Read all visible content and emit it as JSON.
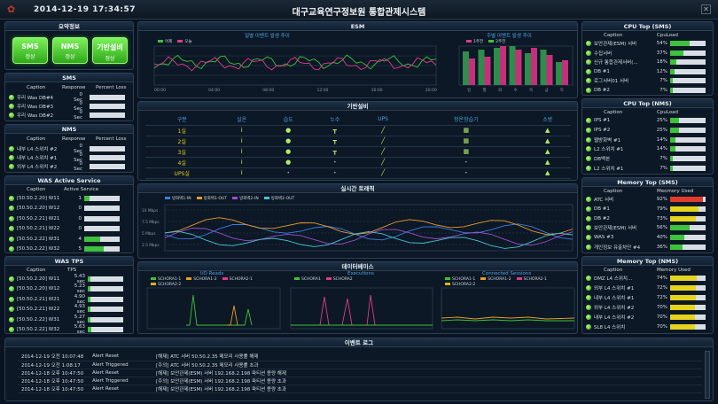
{
  "header": {
    "logo_icon": "red-flower-logo",
    "clock": "2014-12-19 17:34:57",
    "title": "대구교육연구정보원 통합관제시스템",
    "close_icon": "close-icon",
    "close_glyph": "✕"
  },
  "summary": {
    "title": "요약정보",
    "buttons": [
      {
        "label": "SMS",
        "status": "정상"
      },
      {
        "label": "NMS",
        "status": "정상"
      },
      {
        "label": "기반설비",
        "status": "정상"
      }
    ]
  },
  "sms": {
    "title": "SMS",
    "columns": [
      "Caption",
      "Response",
      "Percent Loss"
    ],
    "rows": [
      {
        "caption": "우리 Was DB#4",
        "response": "0 Sec"
      },
      {
        "caption": "우리 Was DB#3",
        "response": "0 Sec"
      },
      {
        "caption": "우리 Was DB#2",
        "response": "0 Sec"
      }
    ]
  },
  "nms": {
    "title": "NMS",
    "columns": [
      "Caption",
      "Response",
      "Percent Loss"
    ],
    "rows": [
      {
        "caption": "내부 L4 스위치 #2",
        "response": "0 Sec"
      },
      {
        "caption": "내부 L4 스위치 #1",
        "response": "0 Sec"
      },
      {
        "caption": "외부 L4 스위치 #2",
        "response": "0 Sec"
      }
    ]
  },
  "was_active": {
    "title": "WAS Active Service",
    "columns": [
      "Caption",
      "Active Service"
    ],
    "rows": [
      {
        "caption": "[50.50.2.20] W11",
        "value": "1",
        "fill": 0.15
      },
      {
        "caption": "[50.50.2.20] W12",
        "value": "0",
        "fill": 0
      },
      {
        "caption": "[50.50.2.21] W21",
        "value": "0",
        "fill": 0
      },
      {
        "caption": "[50.50.2.21] W22",
        "value": "0",
        "fill": 0
      },
      {
        "caption": "[50.50.2.22] W31",
        "value": "4",
        "fill": 0.45
      },
      {
        "caption": "[50.50.2.22] W32",
        "value": "5",
        "fill": 0.55
      }
    ]
  },
  "was_tps": {
    "title": "WAS TPS",
    "columns": [
      "Caption",
      "TPS"
    ],
    "rows": [
      {
        "caption": "[50.50.2.20] W11",
        "value": "5.43 sec",
        "fill": 0.08
      },
      {
        "caption": "[50.50.2.20] W12",
        "value": "5.23 sec",
        "fill": 0.08
      },
      {
        "caption": "[50.50.2.21] W21",
        "value": "4.90 sec",
        "fill": 0.07
      },
      {
        "caption": "[50.50.2.21] W22",
        "value": "4.93 sec",
        "fill": 0.07
      },
      {
        "caption": "[50.50.2.22] W31",
        "value": "5.27 sec",
        "fill": 0.08
      },
      {
        "caption": "[50.50.2.22] W32",
        "value": "5.63 sec",
        "fill": 0.09
      }
    ]
  },
  "esm": {
    "title": "ESM",
    "left_title": "일별 이벤트 발생 추이",
    "right_title": "주별 이벤트 발생 추이",
    "left_legend": [
      "어제",
      "오늘"
    ],
    "right_legend": [
      "1주전",
      "2주전"
    ],
    "left_x": [
      "00:00",
      "04:00",
      "08:00",
      "12:00",
      "16:00",
      "20:00"
    ],
    "right_x": [
      "일",
      "월",
      "화",
      "수",
      "목",
      "금",
      "토"
    ]
  },
  "facility": {
    "title": "기반설비",
    "columns": [
      "구분",
      "실온",
      "습도",
      "누수",
      "UPS",
      "항온항습기",
      "소방"
    ],
    "rows": [
      "1실",
      "2실",
      "3실",
      "4실",
      "UPS실"
    ]
  },
  "traffic": {
    "title": "실시간 트래픽",
    "legend": [
      "방화벽1-IN",
      "방화벽1-OUT",
      "방화벽2-IN",
      "방화벽2-OUT"
    ],
    "legend_colors": [
      "#3a7fe0",
      "#e89a2a",
      "#9a4fd0",
      "#47c1d6"
    ],
    "y": [
      "10 Mbps",
      "7.5 Mbps",
      "5 Mbps",
      "2.5 Mbps"
    ]
  },
  "database": {
    "title": "데이터베이스",
    "io_title": "I/O Reads",
    "exec_title": "Executions",
    "sess_title": "Connected Sessions",
    "io_legend": [
      "SCHORA1-1",
      "SCHORA1-2",
      "SCHORA2-1",
      "SCHORA2-2"
    ],
    "exec_legend": [
      "SCHORA1",
      "SCHORA2"
    ],
    "sess_legend": [
      "SCHORA1-1",
      "SCHORA1-2",
      "SCHORA2-1",
      "SCHORA2-2"
    ]
  },
  "cpu_sms": {
    "title": "CPU Top (SMS)",
    "columns": [
      "Caption",
      "CpuLoad"
    ],
    "rows": [
      {
        "caption": "보안관제(ESM) 서버",
        "value": "54%",
        "fill": 0.54
      },
      {
        "caption": "수집서버",
        "value": "37%",
        "fill": 0.37
      },
      {
        "caption": "신규 통합관제서버(...",
        "value": "18%",
        "fill": 0.18
      },
      {
        "caption": "DB #1",
        "value": "12%",
        "fill": 0.12
      },
      {
        "caption": "로그서버01 서버",
        "value": "7%",
        "fill": 0.07
      },
      {
        "caption": "DB #2",
        "value": "7%",
        "fill": 0.07
      }
    ]
  },
  "cpu_nms": {
    "title": "CPU Top (NMS)",
    "columns": [
      "Caption",
      "CpuLoad"
    ],
    "rows": [
      {
        "caption": "IPS #1",
        "value": "25%",
        "fill": 0.25
      },
      {
        "caption": "IPS #2",
        "value": "25%",
        "fill": 0.25
      },
      {
        "caption": "웹방화벽 #1",
        "value": "14%",
        "fill": 0.14
      },
      {
        "caption": "L2 스위치 #1",
        "value": "14%",
        "fill": 0.14
      },
      {
        "caption": "DB백본",
        "value": "7%",
        "fill": 0.07
      },
      {
        "caption": "L2 스위치 #1",
        "value": "7%",
        "fill": 0.07
      }
    ]
  },
  "mem_sms": {
    "title": "Memory Top (SMS)",
    "columns": [
      "Caption",
      "Meomory Used"
    ],
    "rows": [
      {
        "caption": "ATC 서버",
        "value": "92%",
        "fill": 0.92,
        "color": "r"
      },
      {
        "caption": "DB #1",
        "value": "79%",
        "fill": 0.79,
        "color": "y"
      },
      {
        "caption": "DB #2",
        "value": "73%",
        "fill": 0.73,
        "color": "y"
      },
      {
        "caption": "보안관제(ESM) 서버",
        "value": "56%",
        "fill": 0.56,
        "color": "g"
      },
      {
        "caption": "WAS #3",
        "value": "40%",
        "fill": 0.4,
        "color": "g"
      },
      {
        "caption": "개인정보 유출차단 #4",
        "value": "36%",
        "fill": 0.36,
        "color": "g"
      }
    ]
  },
  "mem_nms": {
    "title": "Memory Top (NMS)",
    "columns": [
      "Caption",
      "Memory Used"
    ],
    "rows": [
      {
        "caption": "DMZ L4 스위치...",
        "value": "74%",
        "fill": 0.74,
        "color": "y"
      },
      {
        "caption": "외부 L4 스위치 #1",
        "value": "72%",
        "fill": 0.72,
        "color": "y"
      },
      {
        "caption": "내부 L4 스위치 #1",
        "value": "72%",
        "fill": 0.72,
        "color": "y"
      },
      {
        "caption": "외부 L4 스위치 #2",
        "value": "70%",
        "fill": 0.7,
        "color": "y"
      },
      {
        "caption": "내부 L4 스위치 #2",
        "value": "70%",
        "fill": 0.7,
        "color": "y"
      },
      {
        "caption": "SL8 L4 스위치",
        "value": "70%",
        "fill": 0.7,
        "color": "y"
      }
    ]
  },
  "events": {
    "title": "이벤트 로그",
    "rows": [
      {
        "time": "2014-12-19 오전 10:07:48",
        "type": "Alert Reset",
        "msg": "[해제] ATC 서버 50.50.2.35 메모리 사용률 해제"
      },
      {
        "time": "2014-12-19 오전 1:08:17",
        "type": "Alert Triggered",
        "msg": "[주의] ATC 서버 50.50.2.35 메모리 사용률 초과"
      },
      {
        "time": "2014-12-18 오후 10:47:50",
        "type": "Alert Reset",
        "msg": "[해제] 보안관제(ESM) 서버 192.168.2.198 파티션 용량 해제"
      },
      {
        "time": "2014-12-18 오후 10:47:50",
        "type": "Alert Triggered",
        "msg": "[주의] 보안관제(ESM) 서버 192.168.2.198 파티션 용량 초과"
      },
      {
        "time": "2014-12-18 오후 10:47:50",
        "type": "Alert Reset",
        "msg": "[해제] 보안관제(ESM) 서버 192.168.2.198 파티션 용량 초과"
      }
    ]
  },
  "colors": {
    "ok_green": "#3cc23c",
    "warn_yellow": "#e6d31e",
    "crit_red": "#e03b2c",
    "accent_blue": "#4fa3e8"
  }
}
